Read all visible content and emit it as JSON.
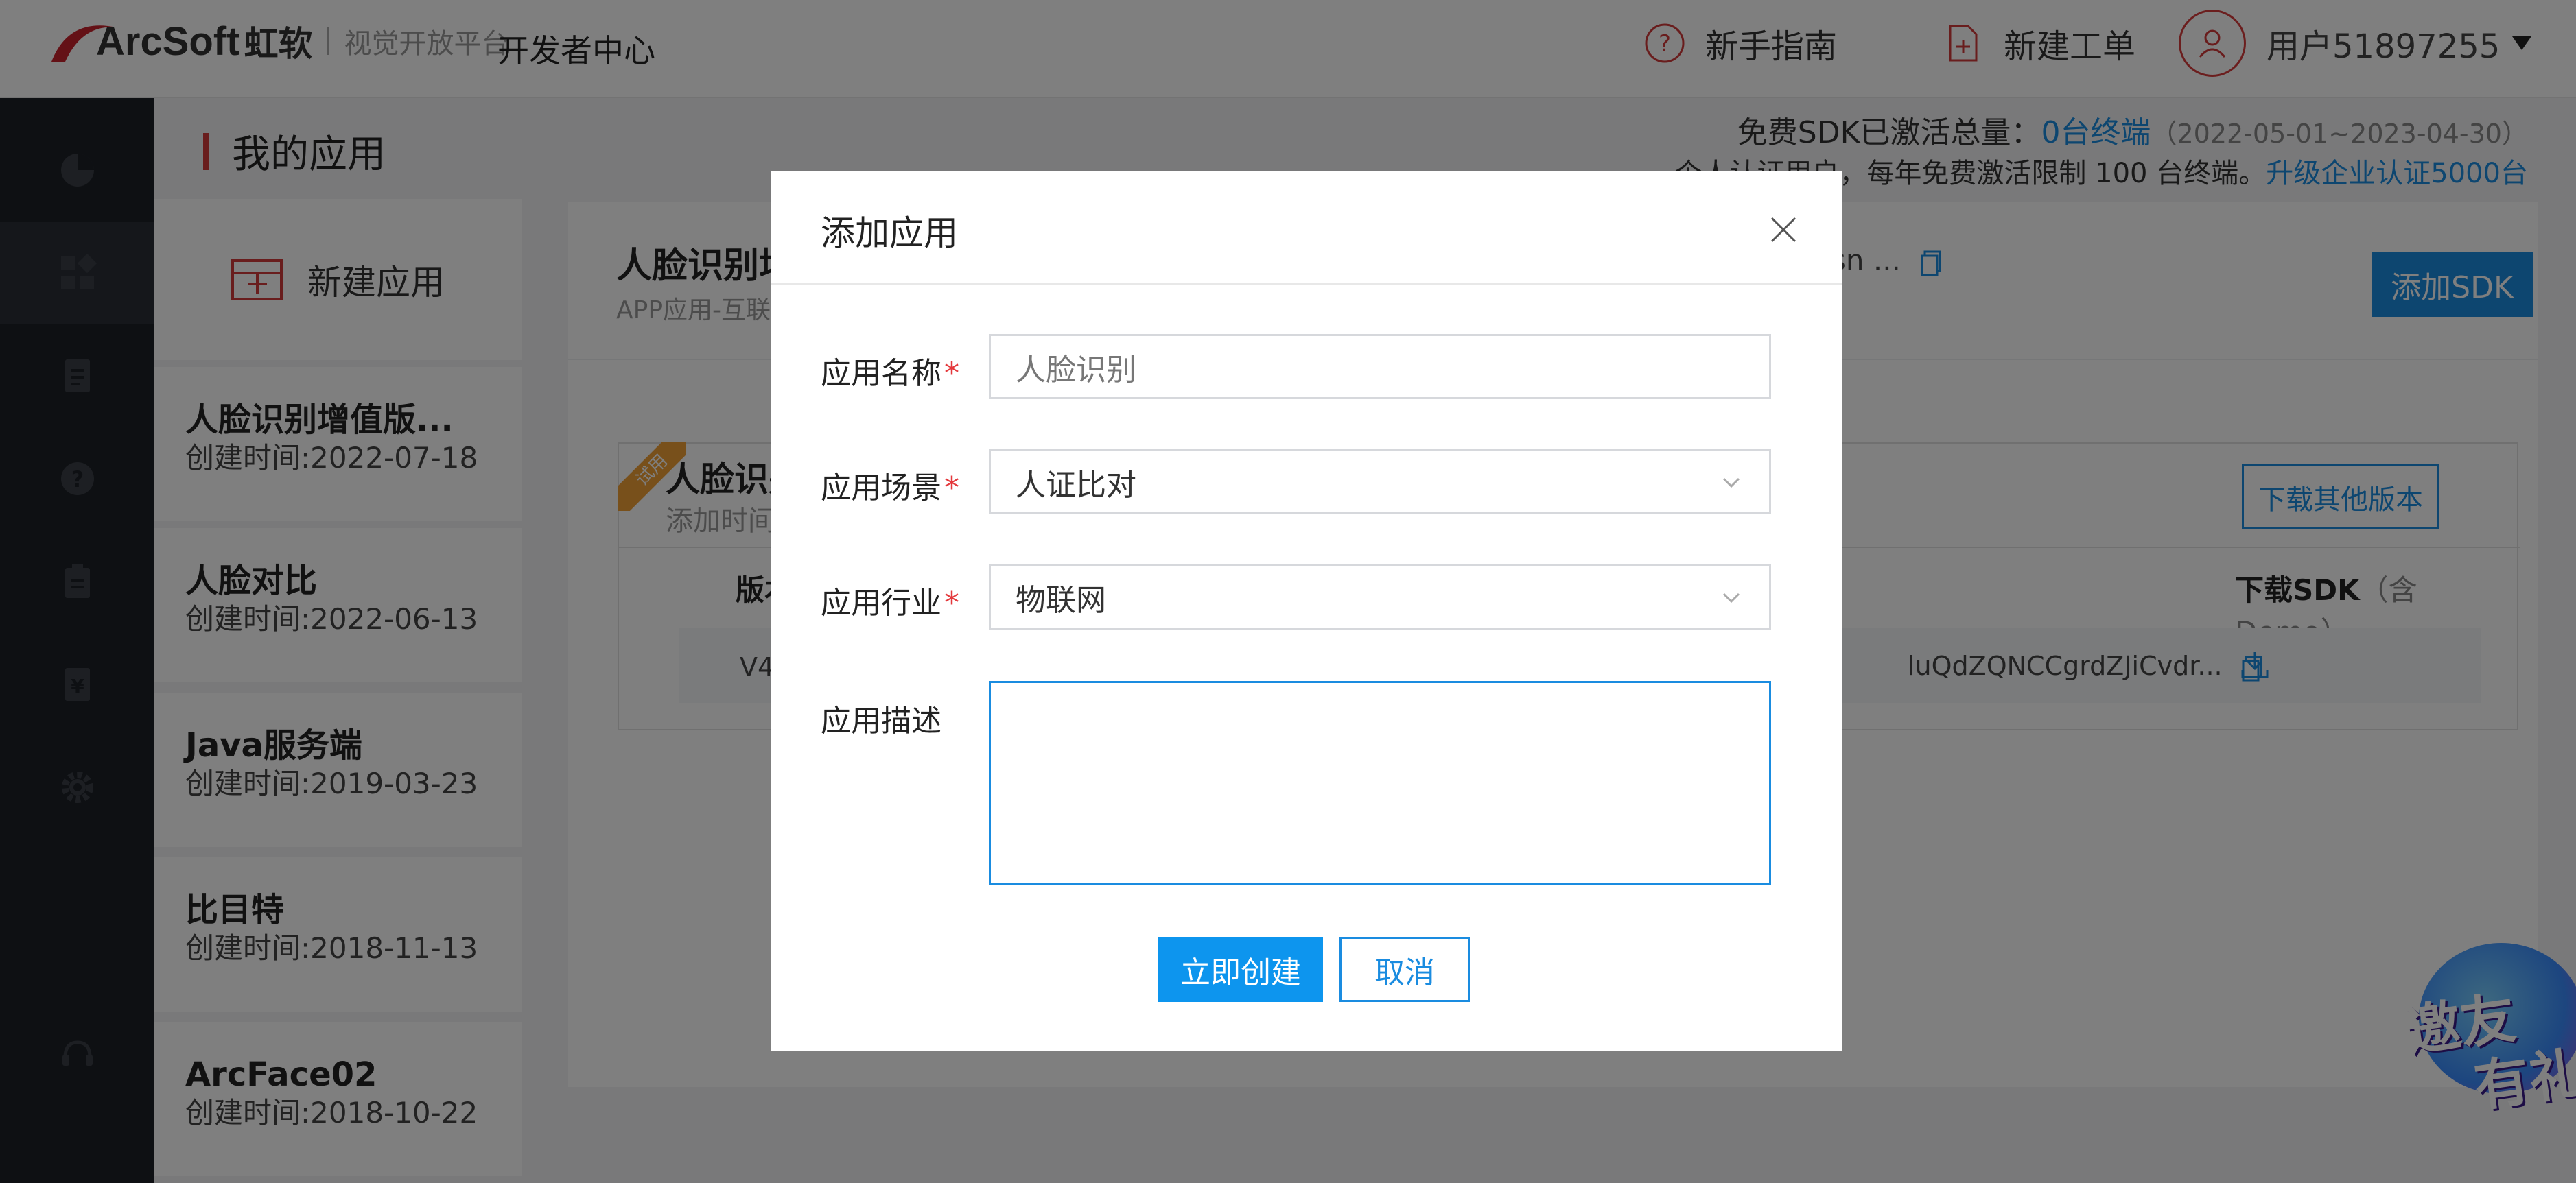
{
  "header": {
    "logo_text": "ArcSoft",
    "logo_cn": "虹软",
    "platform": "视觉开放平台",
    "dev_center": "开发者中心",
    "guide": "新手指南",
    "new_ticket": "新建工单",
    "user": "用户51897255"
  },
  "page": {
    "title": "我的应用",
    "quota_label": "免费SDK已激活总量：",
    "quota_value": "0台终端",
    "quota_period": "（2022-05-01~2023-04-30）",
    "quota_note": "个人认证用户，每年免费激活限制 100 台终端。",
    "upgrade_link": "升级企业认证5000台"
  },
  "app_list": {
    "new_app": "新建应用",
    "apps": [
      {
        "name": "人脸识别增值版...",
        "time": "创建时间:2022-07-18"
      },
      {
        "name": "人脸对比",
        "time": "创建时间:2022-06-13"
      },
      {
        "name": "Java服务端",
        "time": "创建时间:2019-03-23"
      },
      {
        "name": "比目特",
        "time": "创建时间:2018-11-13"
      },
      {
        "name": "ArcFace02",
        "time": "创建时间:2018-10-22"
      }
    ]
  },
  "main": {
    "title": "人脸识别增",
    "subtitle": "APP应用-互联",
    "key_partial": "sn ...",
    "add_sdk": "添加SDK",
    "sdk_name": "人脸识别",
    "sdk_added": "添加时间",
    "trial": "试用",
    "download_other": "下载其他版本",
    "col_version": "版本",
    "col_download": "下载SDK",
    "col_download_note": "（含Demo）",
    "row_version": "V4",
    "row_key": "luQdZQNCCgrdZJiCvdr..."
  },
  "modal": {
    "title": "添加应用",
    "name_label": "应用名称",
    "name_value": "人脸识别",
    "scene_label": "应用场景",
    "scene_value": "人证比对",
    "industry_label": "应用行业",
    "industry_value": "物联网",
    "desc_label": "应用描述",
    "desc_value": "",
    "required_mark": "*",
    "create": "立即创建",
    "cancel": "取消"
  },
  "promo": {
    "line1": "邀友",
    "line2": "有礼"
  },
  "colors": {
    "accent": "#1a8ce0",
    "brand_red": "#d23a3a",
    "sidebar": "#1c2026"
  }
}
